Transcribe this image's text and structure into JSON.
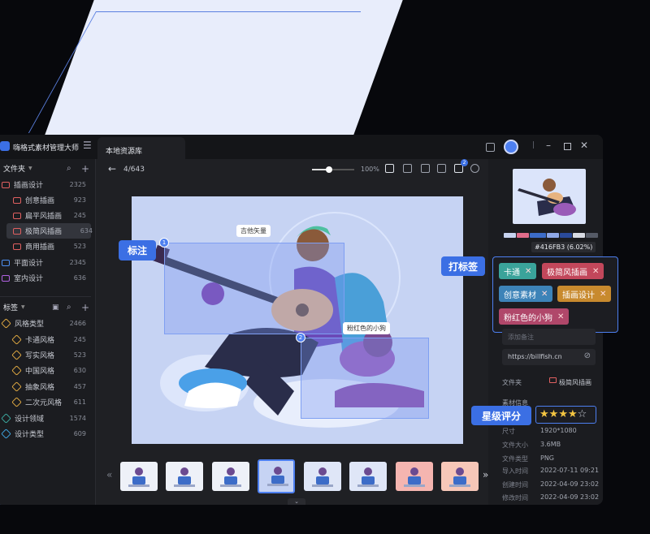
{
  "app": {
    "title": "嗨格式素材管理大师",
    "tab": "本地资源库"
  },
  "sidebar": {
    "folders_header": "文件夹",
    "folders": [
      {
        "label": "插画设计",
        "count": "2325",
        "color": "#e06060"
      },
      {
        "label": "创意插画",
        "count": "923",
        "color": "#e06060"
      },
      {
        "label": "扁平风插画",
        "count": "245",
        "color": "#e06060"
      },
      {
        "label": "极简风插画",
        "count": "634",
        "color": "#e06060"
      },
      {
        "label": "商用插画",
        "count": "523",
        "color": "#e06060"
      },
      {
        "label": "平面设计",
        "count": "2345",
        "color": "#4d8ff0"
      },
      {
        "label": "室内设计",
        "count": "636",
        "color": "#b062e0"
      }
    ],
    "tags_header": "标签",
    "tags": [
      {
        "label": "风格类型",
        "count": "2466"
      },
      {
        "label": "卡通风格",
        "count": "245"
      },
      {
        "label": "写实风格",
        "count": "523"
      },
      {
        "label": "中国风格",
        "count": "630"
      },
      {
        "label": "抽象风格",
        "count": "457"
      },
      {
        "label": "二次元风格",
        "count": "611"
      },
      {
        "label": "设计领域",
        "count": "1574"
      },
      {
        "label": "设计类型",
        "count": "609"
      }
    ]
  },
  "toolbar": {
    "counter": "4/643",
    "zoom": "100%",
    "zoom_level": 0.4
  },
  "canvas": {
    "bubble1": "吉他矢量",
    "bubble2": "粉红色的小狗",
    "marker1": "1",
    "marker2": "2"
  },
  "callouts": {
    "annotate": "标注",
    "tagging": "打标签",
    "rating": "星级评分"
  },
  "tags_panel": [
    {
      "label": "卡通",
      "color": "#3aa39a"
    },
    {
      "label": "极简风插画",
      "color": "#c2475b"
    },
    {
      "label": "创意素材",
      "color": "#3d83b8"
    },
    {
      "label": "插画设计",
      "color": "#c88a2e"
    },
    {
      "label": "粉红色的小狗",
      "color": "#b0476a"
    }
  ],
  "details": {
    "color_hex": "#416FB3 (6.02%)",
    "palette": [
      "#c7d3f0",
      "#e06c8a",
      "#3c6cc8",
      "#8fa8e8",
      "#2a4a9a",
      "#d8dbe3",
      "#555a66"
    ],
    "add_note": "添加备注",
    "url": "https://billfish.cn",
    "folder_label": "文件夹",
    "folder_value": "极简风插画",
    "info_title": "素材信息",
    "rating": 4,
    "rating_max": 5,
    "rows": [
      {
        "k": "尺寸",
        "v": "1920*1080"
      },
      {
        "k": "文件大小",
        "v": "3.6MB"
      },
      {
        "k": "文件类型",
        "v": "PNG"
      },
      {
        "k": "导入时间",
        "v": "2022-07-11 09:21"
      },
      {
        "k": "创建时间",
        "v": "2022-04-09 23:02"
      },
      {
        "k": "修改时间",
        "v": "2022-04-09 23:02"
      }
    ]
  },
  "strip": {
    "prev": "«",
    "next": "»",
    "thumb_colors": [
      "#eef1f8",
      "#eef1f8",
      "#eef1f8",
      "#c6d3f3",
      "#dfe6f7",
      "#dfe6f7",
      "#f5b5b0",
      "#f7c7b8"
    ]
  }
}
